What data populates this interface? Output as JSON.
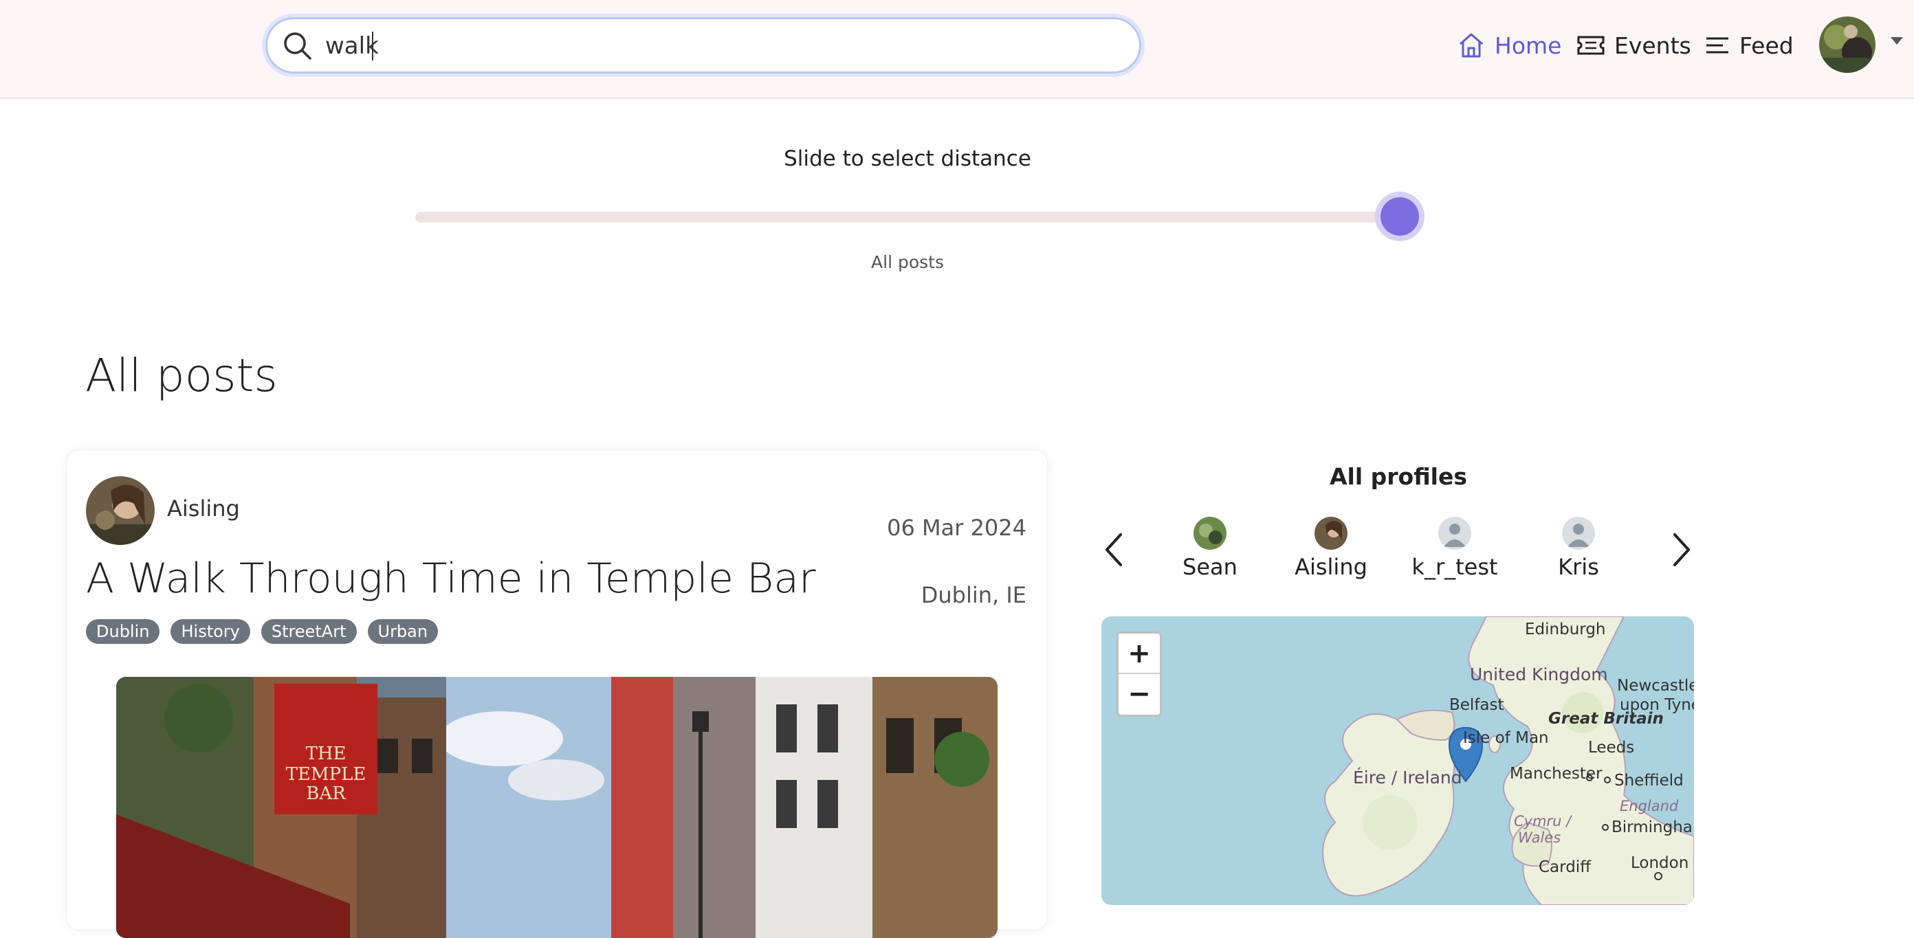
{
  "search": {
    "value": "walk",
    "placeholder": ""
  },
  "nav": {
    "home_label": "Home",
    "events_label": "Events",
    "feed_label": "Feed",
    "active_color": "#5b5bd6"
  },
  "slider": {
    "title": "Slide to select distance",
    "value_label": "All posts",
    "level": 1.0,
    "thumb_color": "#7c6ee0"
  },
  "page_title": "All posts",
  "post": {
    "author": "Aisling",
    "date": "06 Mar 2024",
    "title": "A Walk Through Time in Temple Bar",
    "location": "Dublin, IE",
    "tags": [
      "Dublin",
      "History",
      "StreetArt",
      "Urban"
    ],
    "image_sign_text": [
      "THE",
      "TEMPLE",
      "BAR"
    ]
  },
  "profiles": {
    "title": "All profiles",
    "items": [
      {
        "name": "Sean"
      },
      {
        "name": "Aisling"
      },
      {
        "name": "k_r_test"
      },
      {
        "name": "Kris"
      }
    ]
  },
  "map": {
    "zoom_in_label": "+",
    "zoom_out_label": "−",
    "labels": {
      "edinburgh": "Edinburgh",
      "united_kingdom": "United Kingdom",
      "newcastle_1": "Newcastle",
      "newcastle_2": "upon Tyne",
      "belfast": "Belfast",
      "great_britain": "Great Britain",
      "isle_of_man": "Isle of Man",
      "leeds": "Leeds",
      "eire": "Éire / Ireland",
      "manchester": "Manchester",
      "sheffield": "Sheffield",
      "england": "England",
      "cymru": "Cymru /",
      "wales": "Wales",
      "birmingham": "Birmingham",
      "cardiff": "Cardiff",
      "london": "London"
    }
  }
}
